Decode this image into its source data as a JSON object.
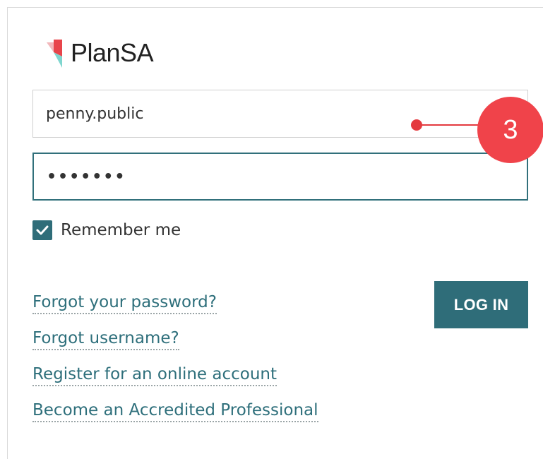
{
  "logo": {
    "text": "PlanSA",
    "colors": {
      "red": "#e8454b",
      "pink": "#f2b8bb",
      "teal": "#7fd6cf"
    }
  },
  "form": {
    "username_value": "penny.public",
    "password_value": "•••••••",
    "remember_label": "Remember me",
    "remember_checked": true,
    "login_label": "LOG IN"
  },
  "links": {
    "forgot_password": "Forgot your password?",
    "forgot_username": "Forgot username?",
    "register": "Register for an online account",
    "accredited": "Become an Accredited Professional"
  },
  "callout": {
    "number": "3",
    "color": "#f0434a"
  },
  "theme": {
    "accent": "#2f6d79",
    "link": "#2e6f7b"
  }
}
